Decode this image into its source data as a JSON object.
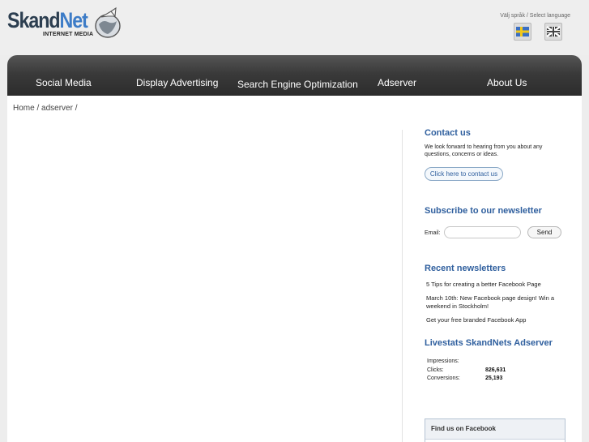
{
  "header": {
    "logo": {
      "text_dark": "Skand",
      "text_blue": "Net",
      "subtitle": "INTERNET MEDIA"
    },
    "language": {
      "label": "Välj språk / Select language",
      "options": [
        {
          "name": "swedish-flag-icon",
          "colors": [
            "#3a6fc4",
            "#f2c81a"
          ]
        },
        {
          "name": "uk-flag-icon",
          "colors": [
            "#333333",
            "#ffffff"
          ]
        }
      ]
    }
  },
  "nav": {
    "items": [
      "Social Media",
      "Display Advertising",
      "Search Engine Optimization",
      "Adserver",
      "About Us"
    ]
  },
  "breadcrumb": {
    "home": "Home",
    "separator": " / ",
    "current": "adserver",
    "trailing": " /"
  },
  "sidebar": {
    "contact": {
      "title": "Contact us",
      "text": "We look forward to hearing from you about any questions, concerns or ideas.",
      "button": "Click here to contact us"
    },
    "newsletter": {
      "title": "Subscribe to our newsletter",
      "email_label": "Email:",
      "email_value": "",
      "send_label": "Send"
    },
    "recent": {
      "title": "Recent newsletters",
      "items": [
        "5 Tips for creating a better Facebook Page",
        "March 10th: New Facebook page design! Win a weekend in Stockholm!",
        "Get your free branded Facebook App"
      ]
    },
    "livestats": {
      "title": "Livestats SkandNets Adserver",
      "impressions_label": "Impressions:",
      "impressions_value": "",
      "clicks_label": "Clicks:",
      "clicks_value": "826,631",
      "conversions_label": "Conversions:",
      "conversions_value": "25,193"
    },
    "facebook": {
      "title": "Find us on Facebook"
    }
  },
  "colors": {
    "accent_blue": "#2f5f9e",
    "nav_dark": "#3a3a3a",
    "page_bg": "#ededed"
  }
}
